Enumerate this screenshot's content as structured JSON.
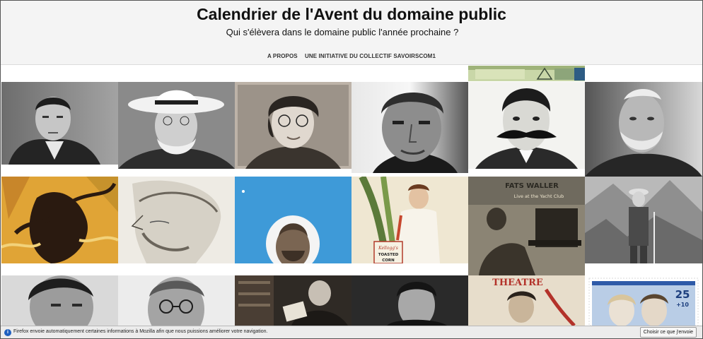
{
  "header": {
    "title": "Calendrier de l'Avent du domaine public",
    "subtitle": "Qui s'élèvera dans le domaine public l'année prochaine ?",
    "nav": [
      {
        "label": "A PROPOS"
      },
      {
        "label": "UNE INITIATIVE DU COLLECTIF SAVOIRSCOM1"
      }
    ]
  },
  "tiles": [
    {
      "name": "portrait-young-man-wing-collar"
    },
    {
      "name": "portrait-man-wide-brim-hat"
    },
    {
      "name": "portrait-woman-round-glasses"
    },
    {
      "name": "portrait-man-closeup"
    },
    {
      "name": "engraving-man-moustache"
    },
    {
      "name": "portrait-old-man-beard"
    },
    {
      "name": "poster-dancer-art-nouveau"
    },
    {
      "name": "sketch-bearded-man-profile"
    },
    {
      "name": "book-cover-blue-bearded-man"
    },
    {
      "name": "advertisement-kelloggs-corn"
    },
    {
      "name": "album-cover-fats-waller",
      "text": "FATS WALLER",
      "text2": "Live at the Yacht Club"
    },
    {
      "name": "photo-hiker-mountain"
    },
    {
      "name": "portrait-man-slick-hair-profile"
    },
    {
      "name": "portrait-man-pince-nez"
    },
    {
      "name": "photo-man-reading-library"
    },
    {
      "name": "portrait-young-man-dark"
    },
    {
      "name": "theatre-poster",
      "text": "THEATRE"
    },
    {
      "name": "stamp-two-faces",
      "value": "25",
      "sub": "+10"
    },
    {
      "name": "banknote-strip"
    }
  ],
  "notification": {
    "text": "Firefox envoie automatiquement certaines informations à Mozilla afin que nous puissions améliorer votre navigation.",
    "button": "Choisir ce que j'envoie",
    "icon": "info-icon"
  }
}
